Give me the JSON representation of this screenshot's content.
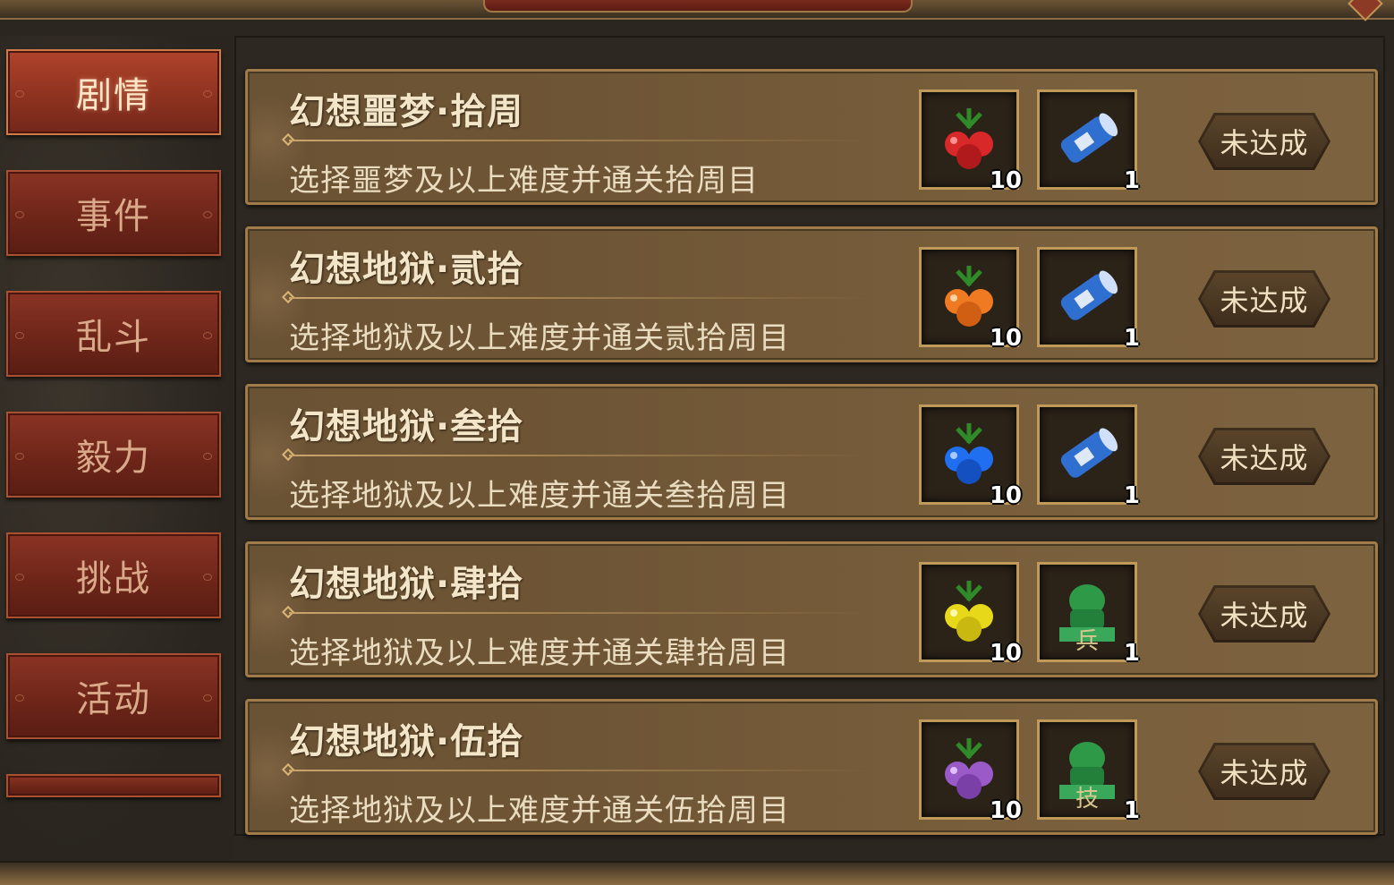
{
  "sidebar": {
    "tabs": [
      {
        "label": "剧情",
        "active": true
      },
      {
        "label": "事件",
        "active": false
      },
      {
        "label": "乱斗",
        "active": false
      },
      {
        "label": "毅力",
        "active": false
      },
      {
        "label": "挑战",
        "active": false
      },
      {
        "label": "活动",
        "active": false
      }
    ]
  },
  "achievements": [
    {
      "title": "幻想噩梦·拾周",
      "description": "选择噩梦及以上难度并通关拾周目",
      "rewards": [
        {
          "icon": "red-fruit-icon",
          "count": "10",
          "color": "#d8282a"
        },
        {
          "icon": "blue-scroll-icon",
          "count": "1",
          "color": "#2f6fd0"
        }
      ],
      "status": "未达成"
    },
    {
      "title": "幻想地狱·贰拾",
      "description": "选择地狱及以上难度并通关贰拾周目",
      "rewards": [
        {
          "icon": "orange-fruit-icon",
          "count": "10",
          "color": "#f07a22"
        },
        {
          "icon": "blue-scroll-icon",
          "count": "1",
          "color": "#2f6fd0"
        }
      ],
      "status": "未达成"
    },
    {
      "title": "幻想地狱·叁拾",
      "description": "选择地狱及以上难度并通关叁拾周目",
      "rewards": [
        {
          "icon": "blue-fruit-icon",
          "count": "10",
          "color": "#1f6ff0"
        },
        {
          "icon": "blue-scroll-icon",
          "count": "1",
          "color": "#2f6fd0"
        }
      ],
      "status": "未达成"
    },
    {
      "title": "幻想地狱·肆拾",
      "description": "选择地狱及以上难度并通关肆拾周目",
      "rewards": [
        {
          "icon": "yellow-fruit-icon",
          "count": "10",
          "color": "#e8d81a"
        },
        {
          "icon": "jade-qilin-statue-icon",
          "count": "1",
          "color": "#2e9a48",
          "glyph": "兵"
        }
      ],
      "status": "未达成"
    },
    {
      "title": "幻想地狱·伍拾",
      "description": "选择地狱及以上难度并通关伍拾周目",
      "rewards": [
        {
          "icon": "purple-fruit-icon",
          "count": "10",
          "color": "#9a5ac8"
        },
        {
          "icon": "jade-qilin-statue-icon",
          "count": "1",
          "color": "#2e9a48",
          "glyph": "技"
        }
      ],
      "status": "未达成"
    }
  ]
}
